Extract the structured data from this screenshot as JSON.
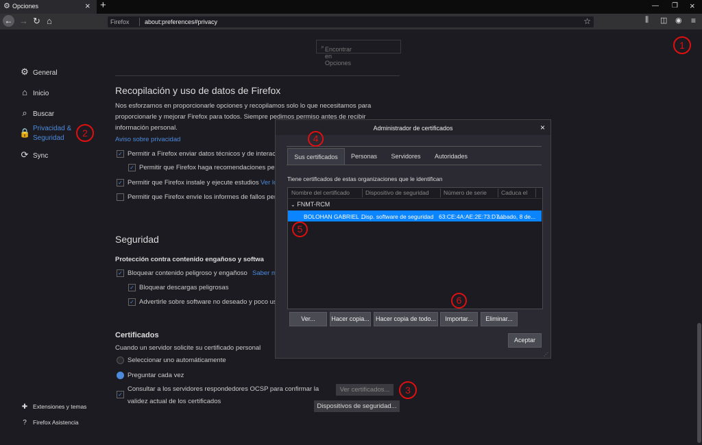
{
  "browser": {
    "tab_title": "Opciones",
    "new_tab": "+",
    "url_identity": "Firefox",
    "url": "about:preferences#privacy"
  },
  "search": {
    "placeholder": "Encontrar en Opciones"
  },
  "sidebar": {
    "items": [
      {
        "label": "General",
        "icon": "gear-icon"
      },
      {
        "label": "Inicio",
        "icon": "home-icon"
      },
      {
        "label": "Buscar",
        "icon": "search-icon"
      },
      {
        "label": "Privacidad &",
        "label2": "Seguridad",
        "icon": "lock-icon"
      },
      {
        "label": "Sync",
        "icon": "sync-icon"
      }
    ],
    "footer": [
      {
        "label": "Extensiones y temas",
        "icon": "puzzle-icon"
      },
      {
        "label": "Firefox Asistencia",
        "icon": "help-icon"
      }
    ]
  },
  "data_collection": {
    "title": "Recopilación y uso de datos de Firefox",
    "desc1": "Nos esforzamos en proporcionarle opciones y recopilamos solo lo que necesitamos para",
    "desc2": "proporcionarle y mejorar Firefox para todos. Siempre pedimos permiso antes de recibir",
    "desc3": "información personal.",
    "link": "Aviso sobre privacidad",
    "opt1": "Permitir a Firefox enviar datos técnicos y de interacc",
    "opt2": "Permitir que Firefox haga recomendaciones pers",
    "opt3": "Permitir que Firefox instale y ejecute estudios",
    "opt3_link": "Ver lo",
    "opt4": "Permitir que Firefox envíe los informes de fallos pen"
  },
  "security": {
    "title": "Seguridad",
    "subtitle": "Protección contra contenido engañoso y softwa",
    "opt1": "Bloquear contenido peligroso y engañoso",
    "opt1_link": "Saber m",
    "opt2": "Bloquear descargas peligrosas",
    "opt3": "Advertirle sobre software no deseado y poco us"
  },
  "certificates": {
    "title": "Certificados",
    "desc": "Cuando un servidor solicite su certificado personal",
    "radio1": "Seleccionar uno automáticamente",
    "radio2": "Preguntar cada vez",
    "ocsp1": "Consultar a los servidores respondedores OCSP para confirmar la",
    "ocsp2": "validez actual de los certificados",
    "view_button": "Ver certificados...",
    "devices_button": "Dispositivos de seguridad..."
  },
  "dialog": {
    "title": "Administrador de certificados",
    "close": "×",
    "tabs": [
      "Sus certificados",
      "Personas",
      "Servidores",
      "Autoridades"
    ],
    "info": "Tiene certificados de estas organizaciones que le identifican",
    "columns": [
      "Nombre del certificado",
      "Dispositivo de seguridad",
      "Número de serie",
      "Caduca el"
    ],
    "group": "FNMT-RCM",
    "row": [
      "BOLOHAN GABRIEL ...",
      "Disp. software de seguridad",
      "63:CE:4A:AE:2E:73:D7...",
      "sábado, 8 de..."
    ],
    "buttons": [
      "Ver...",
      "Hacer copia...",
      "Hacer copia de todo...",
      "Importar...",
      "Eliminar..."
    ],
    "accept": "Aceptar"
  },
  "annotations": [
    "1",
    "2",
    "3",
    "4",
    "5",
    "6"
  ],
  "colors": {
    "accent": "#0a84ff",
    "link": "#4c8bdc",
    "annotation": "#e01010",
    "background": "#1c1b22"
  }
}
